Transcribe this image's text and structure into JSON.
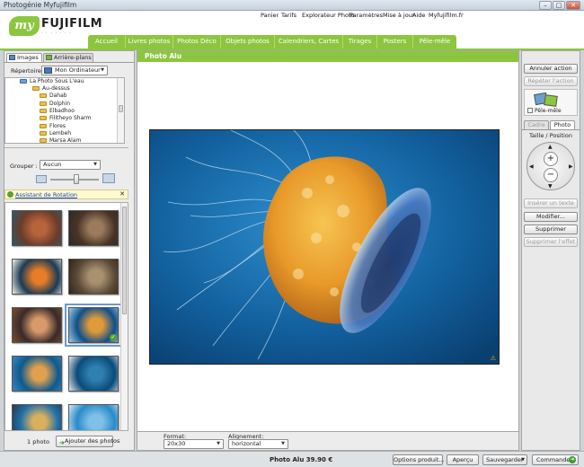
{
  "window": {
    "title": "Photogénie Myfujifilm",
    "minimize": "–",
    "maximize": "□",
    "close": "✕"
  },
  "brand": {
    "my": "my",
    "name": "FUJIFILM",
    "tagline": "· · · · · · ·"
  },
  "top_links": [
    "Panier",
    "Tarifs",
    "Explorateur Photo",
    "Paramètres",
    "Mise à jour",
    "Aide",
    "Myfujifilm.fr"
  ],
  "nav_tabs": [
    "Accueil",
    "Livres photos",
    "Photos Déco",
    "Objets photos",
    "Calendriers, Cartes",
    "Tirages",
    "Posters",
    "Pêle-mêle"
  ],
  "left": {
    "tabs": [
      "Images",
      "Arrière-plans"
    ],
    "repertoire_label": "Répertoire :",
    "repertoire_value": "Mon Ordinateur",
    "tree": [
      "La Photo Sous L'eau",
      "Au-dessus",
      "Dahab",
      "Dolphin",
      "Elbadhoo",
      "Filitheyo Sharm",
      "Flores",
      "Lembeh",
      "Marsa Alam"
    ],
    "grouper_label": "Grouper :",
    "grouper_value": "Aucun",
    "assistant_label": "Assistant de Rotation",
    "assistant_close": "✕",
    "photo_count": "1 photo",
    "add_photos_btn": "Ajouter des photos",
    "thumbnails": [
      {
        "colors": [
          "#6b3b2a",
          "#b5643c",
          "#2d5a6b"
        ]
      },
      {
        "colors": [
          "#4a3326",
          "#9c7a5c",
          "#2a2a2a"
        ]
      },
      {
        "colors": [
          "#1a3b55",
          "#e87c28",
          "#f3f0e8"
        ]
      },
      {
        "colors": [
          "#5c4a38",
          "#a89070",
          "#302418"
        ]
      },
      {
        "colors": [
          "#3a2a2a",
          "#d89a6a",
          "#7a5030"
        ]
      },
      {
        "colors": [
          "#0f4f8a",
          "#e09a3a",
          "#9ecbe8"
        ]
      },
      {
        "colors": [
          "#0d5a8e",
          "#e0a050",
          "#3a86c0"
        ]
      },
      {
        "colors": [
          "#0a4a7a",
          "#2f7fb0",
          "#e6e6e6"
        ]
      },
      {
        "colors": [
          "#1f6fa8",
          "#d8b060",
          "#2a3a4a"
        ]
      },
      {
        "colors": [
          "#2a8ac8",
          "#7ec0e8",
          "#d0e8f5"
        ]
      }
    ]
  },
  "center": {
    "header": "Photo Alu",
    "format_label": "Format:",
    "format_value": "20x30",
    "alignement_label": "Alignement:",
    "alignement_value": "horizontal",
    "warning_icon": "⚠"
  },
  "right": {
    "annuler": "Annuler action",
    "repeter": "Répéter l'action",
    "pele_mele": "Pêle-mêle",
    "tab_cadre": "Cadre",
    "tab_photo": "Photo",
    "taille_position": "Taille / Position",
    "inserer_texte": "Insérer un texte",
    "modifier": "Modifier...",
    "supprimer": "Supprimer",
    "supprimer_effet": "Supprimer l'effet"
  },
  "bottom": {
    "price": "Photo Alu 39.90 €",
    "options": "Options produit...",
    "apercu": "Aperçu",
    "sauvegarder": "Sauvegarder",
    "commander": "Commander"
  }
}
